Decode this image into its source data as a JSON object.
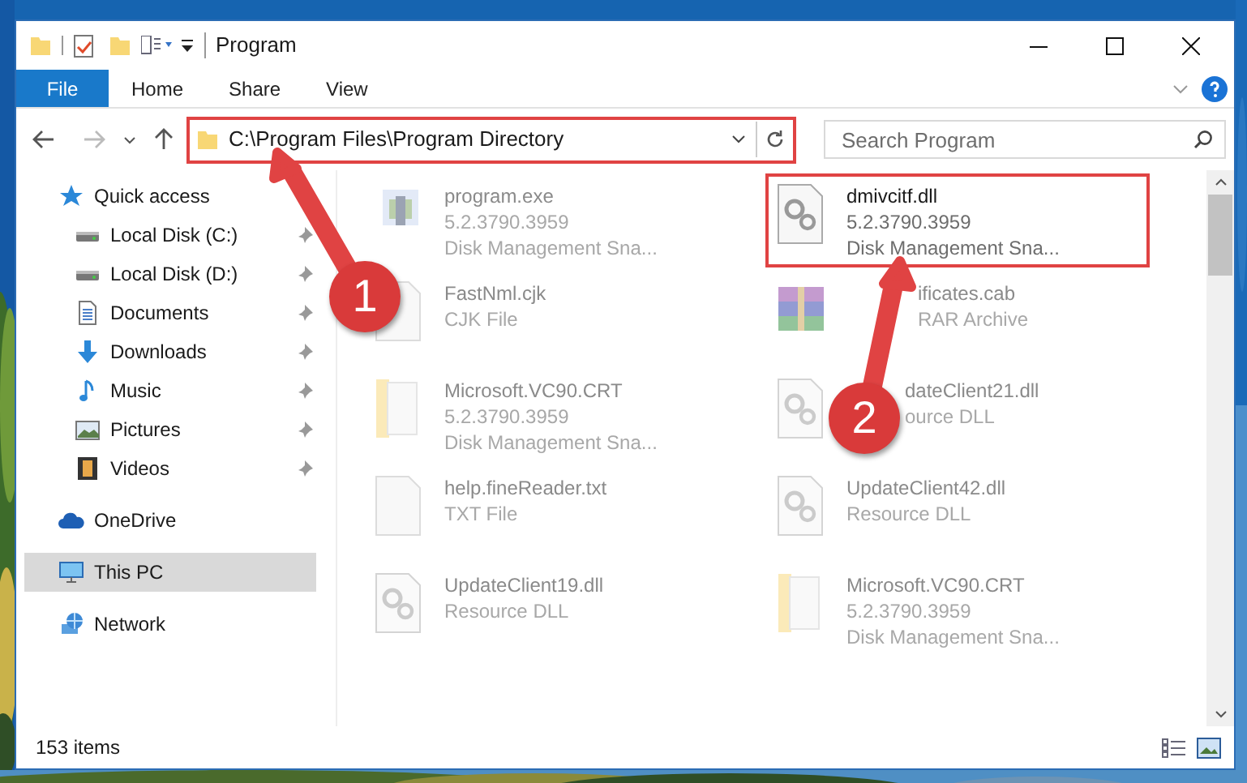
{
  "window": {
    "title": "Program"
  },
  "ribbon": {
    "tabs": [
      {
        "label": "File",
        "selected": true
      },
      {
        "label": "Home",
        "selected": false
      },
      {
        "label": "Share",
        "selected": false
      },
      {
        "label": "View",
        "selected": false
      }
    ]
  },
  "address_bar": {
    "path": "C:\\Program Files\\Program Directory",
    "highlighted": true
  },
  "search": {
    "placeholder": "Search Program"
  },
  "sidebar": {
    "items": [
      {
        "label": "Quick access",
        "kind": "star",
        "selected": false,
        "children": [
          {
            "label": "Local Disk (C:)",
            "kind": "drive",
            "pinned": true,
            "selected": false
          },
          {
            "label": "Local Disk (D:)",
            "kind": "drive",
            "pinned": true,
            "selected": false
          },
          {
            "label": "Documents",
            "kind": "document",
            "pinned": true,
            "selected": false
          },
          {
            "label": "Downloads",
            "kind": "download",
            "pinned": true,
            "selected": false
          },
          {
            "label": "Music",
            "kind": "music",
            "pinned": true,
            "selected": false
          },
          {
            "label": "Pictures",
            "kind": "pictures",
            "pinned": true,
            "selected": false
          },
          {
            "label": "Videos",
            "kind": "video",
            "pinned": true,
            "selected": false
          }
        ]
      },
      {
        "label": "OneDrive",
        "kind": "cloud",
        "selected": false
      },
      {
        "label": "This PC",
        "kind": "computer",
        "selected": true
      },
      {
        "label": "Network",
        "kind": "network",
        "selected": false
      }
    ]
  },
  "files": [
    {
      "kind": "exe",
      "lines": [
        "program.exe",
        "5.2.3790.3959",
        "Disk Management Sna..."
      ],
      "highlighted": false,
      "dimmed": true
    },
    {
      "kind": "dll",
      "lines": [
        "dmivcitf.dll",
        "5.2.3790.3959",
        "Disk Management Sna..."
      ],
      "highlighted": true,
      "dimmed": false
    },
    {
      "kind": "text",
      "lines": [
        "FastNml.cjk",
        "CJK File"
      ],
      "highlighted": false,
      "dimmed": true
    },
    {
      "kind": "archive",
      "lines": [
        "ificates.cab",
        "RAR Archive"
      ],
      "highlighted": false,
      "dimmed": true
    },
    {
      "kind": "folder",
      "lines": [
        "Microsoft.VC90.CRT",
        "5.2.3790.3959",
        "Disk Management Sna..."
      ],
      "highlighted": false,
      "dimmed": true
    },
    {
      "kind": "dll",
      "lines": [
        "dateClient21.dll",
        "ource DLL"
      ],
      "highlighted": false,
      "dimmed": true
    },
    {
      "kind": "text",
      "lines": [
        "help.fineReader.txt",
        "TXT File"
      ],
      "highlighted": false,
      "dimmed": true
    },
    {
      "kind": "dll",
      "lines": [
        "UpdateClient42.dll",
        "Resource DLL"
      ],
      "highlighted": false,
      "dimmed": true
    },
    {
      "kind": "dll",
      "lines": [
        "UpdateClient19.dll",
        "Resource DLL"
      ],
      "highlighted": false,
      "dimmed": true
    },
    {
      "kind": "folder",
      "lines": [
        "Microsoft.VC90.CRT",
        "5.2.3790.3959",
        "Disk Management Sna..."
      ],
      "highlighted": false,
      "dimmed": true
    }
  ],
  "annotations": [
    {
      "number": "1"
    },
    {
      "number": "2"
    }
  ],
  "status_bar": {
    "count": "153 items"
  }
}
